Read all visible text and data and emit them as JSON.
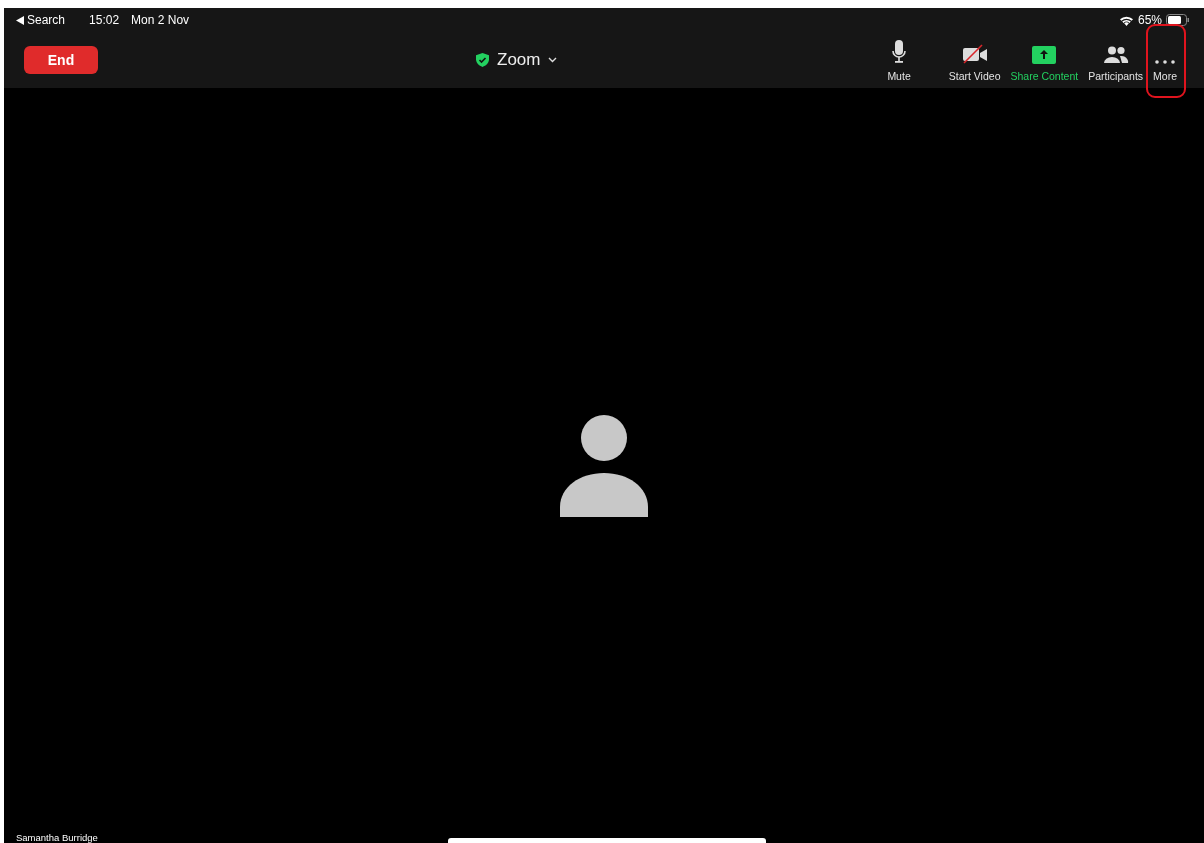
{
  "status_bar": {
    "back_label": "Search",
    "time": "15:02",
    "date": "Mon 2 Nov",
    "battery": "65%"
  },
  "toolbar": {
    "end_button": "End",
    "meeting_title": "Zoom",
    "encrypted": true,
    "actions": [
      {
        "kind": "mic",
        "label": "Mute",
        "active": false,
        "highlighted": false
      },
      {
        "kind": "video",
        "label": "Start Video",
        "active": false,
        "highlighted": false,
        "video_on": false
      },
      {
        "kind": "share",
        "label": "Share Content",
        "active": true,
        "highlighted": false
      },
      {
        "kind": "participants",
        "label": "Participants",
        "active": false,
        "highlighted": false
      },
      {
        "kind": "more",
        "label": "More",
        "active": false,
        "highlighted": true
      }
    ]
  },
  "video": {
    "participant_name": "Samantha Burridge"
  }
}
